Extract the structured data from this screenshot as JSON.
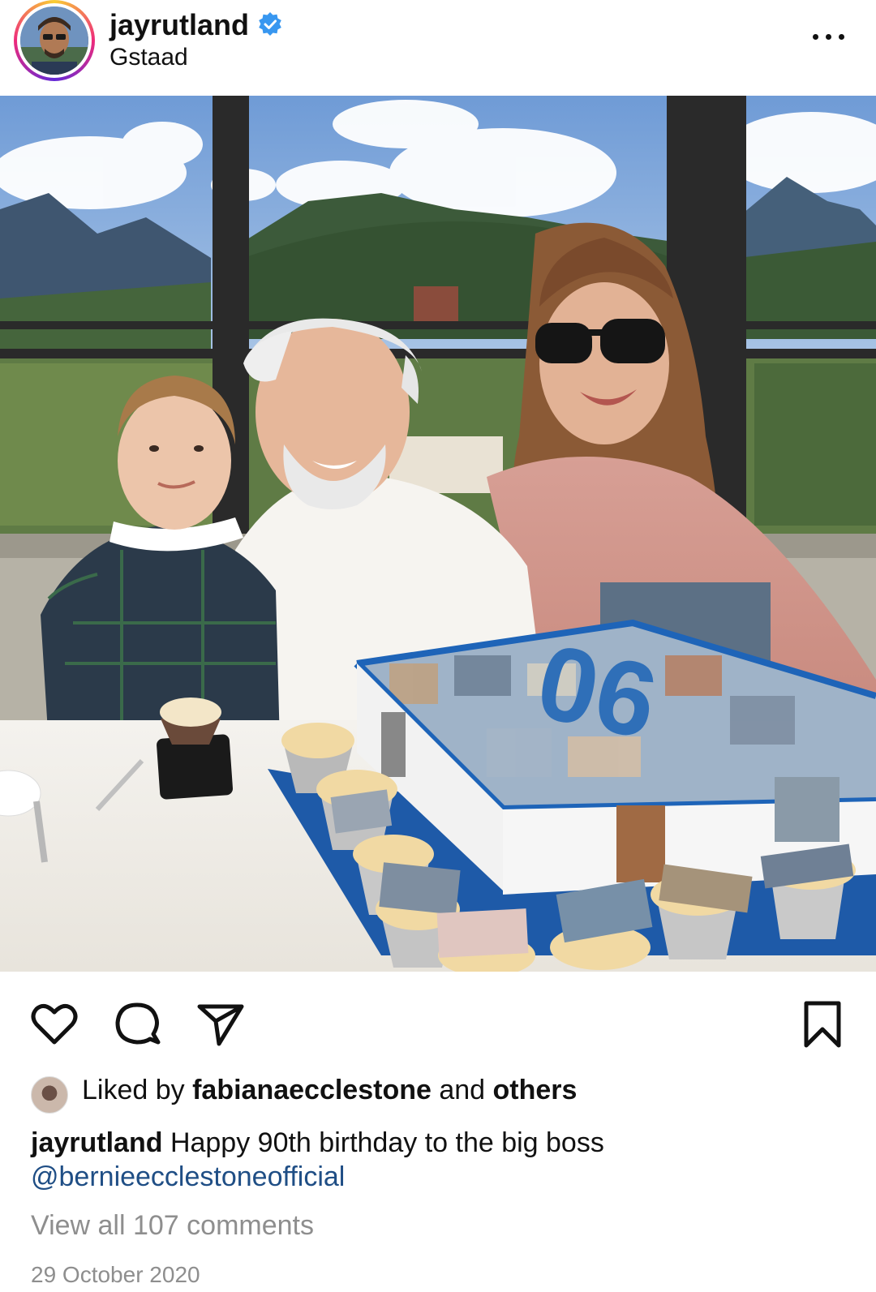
{
  "post": {
    "username": "jayrutland",
    "location": "Gstaad",
    "verified": true,
    "more_icon": "ellipsis-icon"
  },
  "cake": {
    "number_text": "06"
  },
  "actions": {
    "like_icon": "heart-icon",
    "comment_icon": "comment-icon",
    "share_icon": "send-icon",
    "save_icon": "bookmark-icon"
  },
  "likes": {
    "prefix": "Liked by",
    "user": "fabianaecclestone",
    "middle": "and",
    "suffix": "others"
  },
  "caption": {
    "username": "jayrutland",
    "text": "Happy 90th birthday to the big boss",
    "mention": "@bernieecclestoneofficial"
  },
  "comments_link": "View all 107 comments",
  "date": "29 October 2020",
  "colors": {
    "verified_blue": "#3897f0",
    "mention_blue": "#1f4e85",
    "muted_gray": "#8e8e8e"
  }
}
